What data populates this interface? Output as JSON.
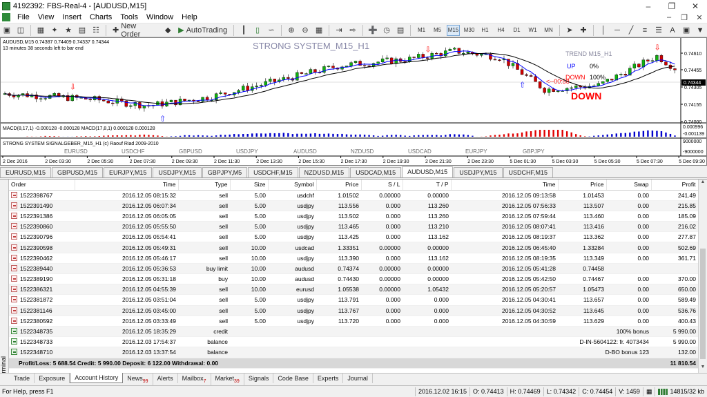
{
  "window": {
    "title": "4192392: FBS-Real-4 - [AUDUSD,M15]"
  },
  "menu": [
    "File",
    "View",
    "Insert",
    "Charts",
    "Tools",
    "Window",
    "Help"
  ],
  "toolbar": {
    "new_order": "New Order",
    "autotrading": "AutoTrading",
    "timeframes": [
      "M1",
      "M5",
      "M15",
      "M30",
      "H1",
      "H4",
      "D1",
      "W1",
      "MN"
    ],
    "active_timeframe": "M15"
  },
  "chart": {
    "header": "AUDUSD,M15  0.74387 0.74409 0.74337 0.74344",
    "countdown": "13 minutes 38 seconds left to bar end",
    "system_title": "STRONG SYSTEM_M15_H1",
    "trend_title": "TREND M15_H1",
    "up_label": "UP",
    "up_value": "0%",
    "down_label": "DOWN",
    "down_value": "100%",
    "timer_label": "<--00:58",
    "signal_label": "DOWN",
    "price_axis": [
      "0.74610",
      "0.74455",
      "0.74305",
      "0.74155",
      "0.74000"
    ],
    "current_price": "0.74344",
    "macd_label": "MACD(8,17,1) -0.000128 -0.000128  MACD(17,8,1) 0.000128 0.000128",
    "macd_axis": [
      "0.000996",
      "-0.001139"
    ],
    "signal_indicator_label": "STRONG SYSTEM SIGNALGEBER_M15_H1 (c) Raouf Riad 2009-2010",
    "signal_axis": [
      "9000000",
      "-9000000"
    ],
    "pairs": [
      "EURUSD",
      "USDCHF",
      "GBPUSD",
      "USDJPY",
      "AUDUSD",
      "NZDUSD",
      "USDCAD",
      "EURJPY",
      "GBPJPY"
    ],
    "time_axis": [
      "2 Dec 2016",
      "2 Dec 03:30",
      "2 Dec 05:30",
      "2 Dec 07:30",
      "2 Dec 09:30",
      "2 Dec 11:30",
      "2 Dec 13:30",
      "2 Dec 15:30",
      "2 Dec 17:30",
      "2 Dec 19:30",
      "2 Dec 21:30",
      "2 Dec 23:30",
      "5 Dec 01:30",
      "5 Dec 03:30",
      "5 Dec 05:30",
      "5 Dec 07:30",
      "5 Dec 09:30"
    ],
    "colors": {
      "bull": "#10b010",
      "bear": "#d00000",
      "ma_blue": "#0000ff",
      "ma_black": "#000000",
      "trend": "#8a8aa0",
      "up": "#0000ff",
      "down": "#ff0000"
    }
  },
  "chart_tabs": [
    "EURUSD,M15",
    "GBPUSD,M15",
    "EURJPY,M15",
    "USDJPY,M15",
    "GBPJPY,M5",
    "USDCHF,M15",
    "NZDUSD,M15",
    "USDCAD,M15",
    "AUDUSD,M15",
    "USDJPY,M15",
    "USDCHF,M15"
  ],
  "active_chart_tab": "AUDUSD,M15",
  "terminal": {
    "side_label": "Terminal",
    "columns": [
      "Order",
      "Time",
      "Type",
      "Size",
      "Symbol",
      "Price",
      "S / L",
      "T / P",
      "Time",
      "Price",
      "Swap",
      "Profit"
    ],
    "rows": [
      {
        "order": "1522398767",
        "time": "2016.12.05 08:15:32",
        "type": "sell",
        "size": "5.00",
        "symbol": "usdchf",
        "price": "1.01502",
        "sl": "0.00000",
        "tp": "0.00000",
        "ctime": "2016.12.05 09:13:58",
        "cprice": "1.01453",
        "swap": "0.00",
        "profit": "241.49"
      },
      {
        "order": "1522391490",
        "time": "2016.12.05 06:07:34",
        "type": "sell",
        "size": "5.00",
        "symbol": "usdjpy",
        "price": "113.556",
        "sl": "0.000",
        "tp": "113.260",
        "ctime": "2016.12.05 07:56:33",
        "cprice": "113.507",
        "swap": "0.00",
        "profit": "215.85"
      },
      {
        "order": "1522391386",
        "time": "2016.12.05 06:05:05",
        "type": "sell",
        "size": "5.00",
        "symbol": "usdjpy",
        "price": "113.502",
        "sl": "0.000",
        "tp": "113.260",
        "ctime": "2016.12.05 07:59:44",
        "cprice": "113.460",
        "swap": "0.00",
        "profit": "185.09"
      },
      {
        "order": "1522390860",
        "time": "2016.12.05 05:55:50",
        "type": "sell",
        "size": "5.00",
        "symbol": "usdjpy",
        "price": "113.465",
        "sl": "0.000",
        "tp": "113.210",
        "ctime": "2016.12.05 08:07:41",
        "cprice": "113.416",
        "swap": "0.00",
        "profit": "216.02"
      },
      {
        "order": "1522390796",
        "time": "2016.12.05 05:54:41",
        "type": "sell",
        "size": "5.00",
        "symbol": "usdjpy",
        "price": "113.425",
        "sl": "0.000",
        "tp": "113.162",
        "ctime": "2016.12.05 08:19:37",
        "cprice": "113.362",
        "swap": "0.00",
        "profit": "277.87"
      },
      {
        "order": "1522390598",
        "time": "2016.12.05 05:49:31",
        "type": "sell",
        "size": "10.00",
        "symbol": "usdcad",
        "price": "1.33351",
        "sl": "0.00000",
        "tp": "0.00000",
        "ctime": "2016.12.05 06:45:40",
        "cprice": "1.33284",
        "swap": "0.00",
        "profit": "502.69"
      },
      {
        "order": "1522390462",
        "time": "2016.12.05 05:46:17",
        "type": "sell",
        "size": "10.00",
        "symbol": "usdjpy",
        "price": "113.390",
        "sl": "0.000",
        "tp": "113.162",
        "ctime": "2016.12.05 08:19:35",
        "cprice": "113.349",
        "swap": "0.00",
        "profit": "361.71"
      },
      {
        "order": "1522389440",
        "time": "2016.12.05 05:36:53",
        "type": "buy limit",
        "size": "10.00",
        "symbol": "audusd",
        "price": "0.74374",
        "sl": "0.00000",
        "tp": "0.00000",
        "ctime": "2016.12.05 05:41:28",
        "cprice": "0.74458",
        "swap": "",
        "profit": ""
      },
      {
        "order": "1522389190",
        "time": "2016.12.05 05:31:18",
        "type": "buy",
        "size": "10.00",
        "symbol": "audusd",
        "price": "0.74430",
        "sl": "0.00000",
        "tp": "0.00000",
        "ctime": "2016.12.05 05:42:50",
        "cprice": "0.74467",
        "swap": "0.00",
        "profit": "370.00"
      },
      {
        "order": "1522386321",
        "time": "2016.12.05 04:55:39",
        "type": "sell",
        "size": "10.00",
        "symbol": "eurusd",
        "price": "1.05538",
        "sl": "0.00000",
        "tp": "1.05432",
        "ctime": "2016.12.05 05:20:57",
        "cprice": "1.05473",
        "swap": "0.00",
        "profit": "650.00"
      },
      {
        "order": "1522381872",
        "time": "2016.12.05 03:51:04",
        "type": "sell",
        "size": "5.00",
        "symbol": "usdjpy",
        "price": "113.791",
        "sl": "0.000",
        "tp": "0.000",
        "ctime": "2016.12.05 04:30:41",
        "cprice": "113.657",
        "swap": "0.00",
        "profit": "589.49"
      },
      {
        "order": "1522381146",
        "time": "2016.12.05 03:45:00",
        "type": "sell",
        "size": "5.00",
        "symbol": "usdjpy",
        "price": "113.767",
        "sl": "0.000",
        "tp": "0.000",
        "ctime": "2016.12.05 04:30:52",
        "cprice": "113.645",
        "swap": "0.00",
        "profit": "536.76"
      },
      {
        "order": "1522380592",
        "time": "2016.12.05 03:33:49",
        "type": "sell",
        "size": "5.00",
        "symbol": "usdjpy",
        "price": "113.720",
        "sl": "0.000",
        "tp": "0.000",
        "ctime": "2016.12.05 04:30:59",
        "cprice": "113.629",
        "swap": "0.00",
        "profit": "400.43"
      }
    ],
    "balance_rows": [
      {
        "order": "1522348735",
        "time": "2016.12.05 18:35:29",
        "type": "credit",
        "comment": "100% bonus",
        "profit": "5 990.00"
      },
      {
        "order": "1522348733",
        "time": "2016.12.03 17:54:37",
        "type": "balance",
        "comment": "D-IN-5604122: fr. 4073434",
        "profit": "5 990.00"
      },
      {
        "order": "1522348710",
        "time": "2016.12.03 13:37:54",
        "type": "balance",
        "comment": "D-BO bonus 123",
        "profit": "132.00"
      }
    ],
    "total": {
      "summary": "Profit/Loss: 5 688.54  Credit: 5 990.00  Deposit: 6 122.00  Withdrawal: 0.00",
      "profit": "11 810.54"
    },
    "tabs": [
      {
        "label": "Trade",
        "badge": ""
      },
      {
        "label": "Exposure",
        "badge": ""
      },
      {
        "label": "Account History",
        "badge": ""
      },
      {
        "label": "News",
        "badge": "99"
      },
      {
        "label": "Alerts",
        "badge": ""
      },
      {
        "label": "Mailbox",
        "badge": "7"
      },
      {
        "label": "Market",
        "badge": "39"
      },
      {
        "label": "Signals",
        "badge": ""
      },
      {
        "label": "Code Base",
        "badge": ""
      },
      {
        "label": "Experts",
        "badge": ""
      },
      {
        "label": "Journal",
        "badge": ""
      }
    ],
    "active_tab": "Account History"
  },
  "status": {
    "help": "For Help, press F1",
    "datetime": "2016.12.02 16:15",
    "open": "O: 0.74413",
    "high": "H: 0.74469",
    "low": "L: 0.74342",
    "close": "C: 0.74454",
    "volume": "V: 1459",
    "traffic": "14815/32 kb"
  }
}
